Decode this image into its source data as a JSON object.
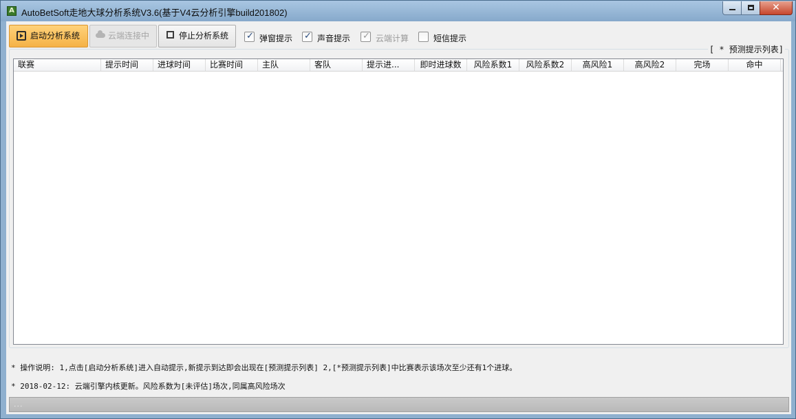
{
  "window": {
    "title": "AutoBetSoft走地大球分析系统V3.6(基于V4云分析引擎build201802)",
    "app_icon_letter": "A"
  },
  "toolbar": {
    "start_label": "启动分析系统",
    "cloud_label": "云端连接中",
    "stop_label": "停止分析系统"
  },
  "options": [
    {
      "label": "弹窗提示",
      "checked": true,
      "enabled": true
    },
    {
      "label": "声音提示",
      "checked": true,
      "enabled": true
    },
    {
      "label": "云端计算",
      "checked": true,
      "enabled": false
    },
    {
      "label": "短信提示",
      "checked": false,
      "enabled": true
    }
  ],
  "list": {
    "group_title": "[ * 预测提示列表]",
    "columns": [
      "联赛",
      "提示时间",
      "进球时间",
      "比赛时间",
      "主队",
      "客队",
      "提示进...",
      "即时进球数",
      "风险系数1",
      "风险系数2",
      "高风险1",
      "高风险2",
      "完场",
      "命中"
    ]
  },
  "notes": {
    "line1": "* 操作说明: 1,点击[启动分析系统]进入自动提示,新提示到达即会出现在[预测提示列表] 2,[*预测提示列表]中比赛表示该场次至少还有1个进球。",
    "line2": "* 2018-02-12: 云端引擎内核更新。风险系数为[未评估]场次,同属高风险场次"
  },
  "status": {
    "text": "..."
  },
  "colors": {
    "start_button": "#f5b247",
    "titlebar": "#9dbcdb",
    "close_button": "#c7462c"
  }
}
